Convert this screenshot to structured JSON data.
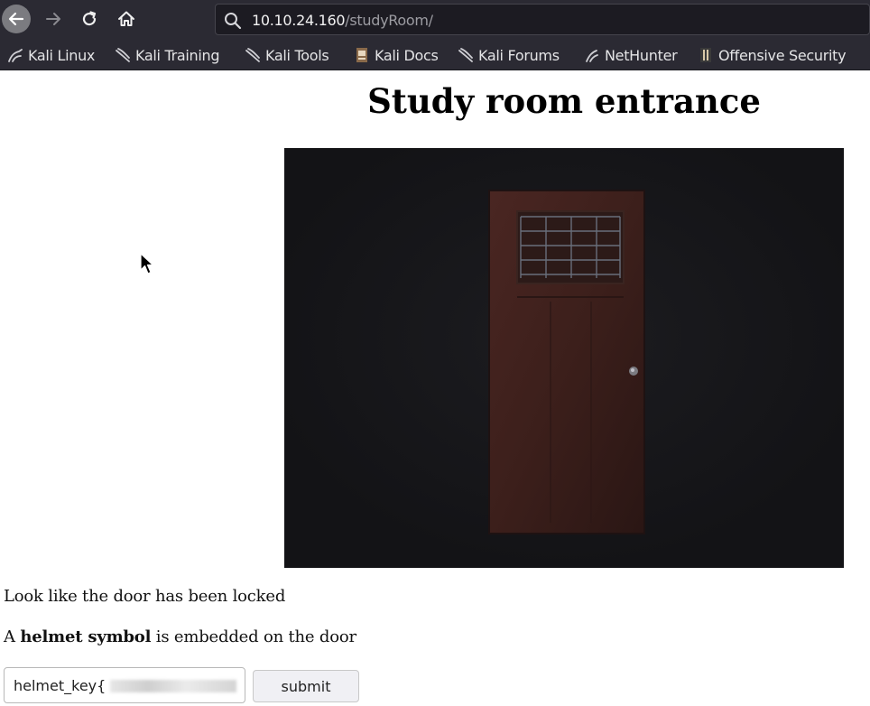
{
  "browser": {
    "url_host": "10.10.24.160",
    "url_path": "/studyRoom/",
    "icons": {
      "back": "arrow-left-icon",
      "forward": "arrow-right-icon",
      "reload": "reload-icon",
      "home": "home-icon",
      "search": "search-icon"
    },
    "bookmarks": [
      {
        "label": "Kali Linux",
        "icon": "kali-dragon-icon"
      },
      {
        "label": "Kali Training",
        "icon": "kali-dragon-icon"
      },
      {
        "label": "Kali Tools",
        "icon": "kali-dragon-icon"
      },
      {
        "label": "Kali Docs",
        "icon": "docs-icon"
      },
      {
        "label": "Kali Forums",
        "icon": "kali-dragon-icon"
      },
      {
        "label": "NetHunter",
        "icon": "nethunter-icon"
      },
      {
        "label": "Offensive Security",
        "icon": "offsec-icon"
      }
    ]
  },
  "page": {
    "title": "Study room entrance",
    "image": "door-image",
    "line1": "Look like the door has been locked",
    "line2_prefix": "A ",
    "line2_bold": "helmet symbol",
    "line2_suffix": " is embedded on the door",
    "key_input_value": "helmet_key{",
    "submit_label": "submit"
  },
  "colors": {
    "chrome_bg": "#2b2a33",
    "urlbar_bg": "#1c1b22",
    "image_bg": "#16171a",
    "door": "#3a1f1c"
  }
}
